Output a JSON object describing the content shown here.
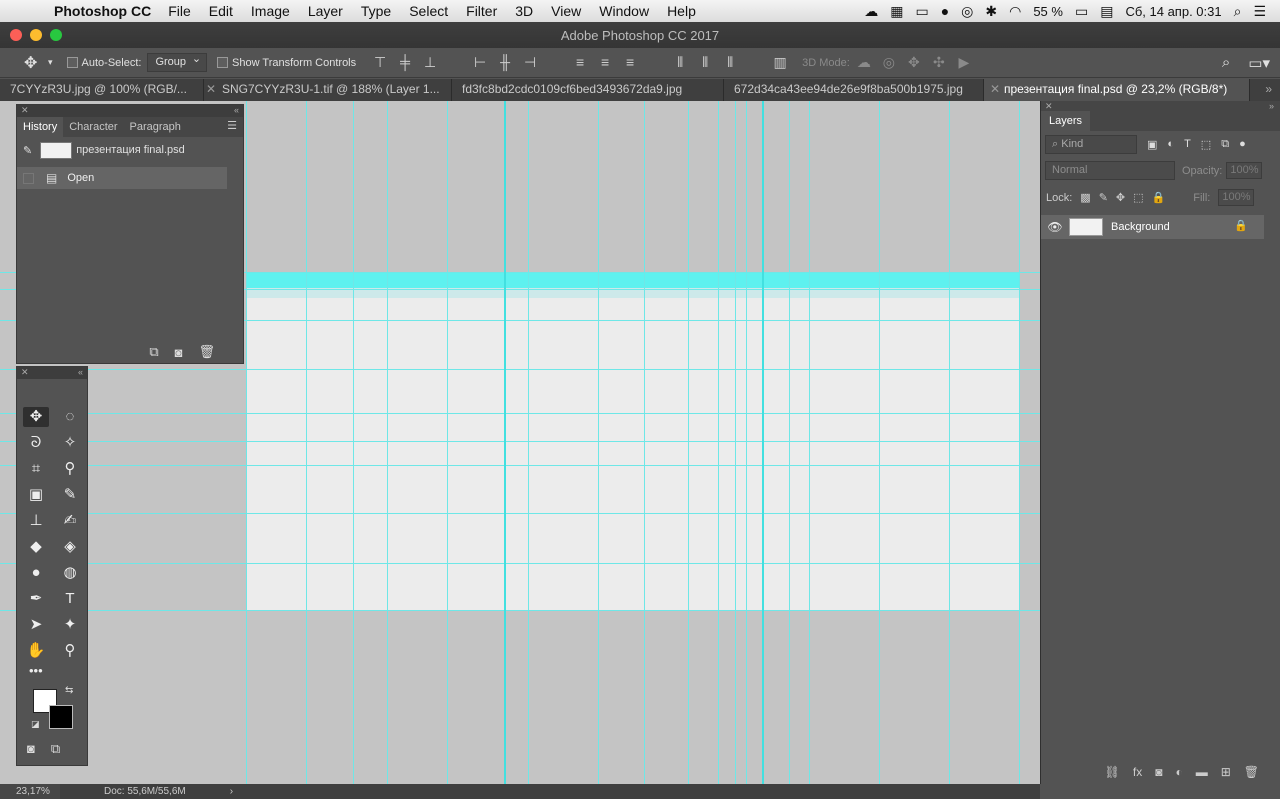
{
  "menubar": {
    "app": "Photoshop CC",
    "items": [
      "File",
      "Edit",
      "Image",
      "Layer",
      "Type",
      "Select",
      "Filter",
      "3D",
      "View",
      "Window",
      "Help"
    ],
    "battery": "55 %",
    "datetime": "Сб, 14 апр.  0:31"
  },
  "window": {
    "title": "Adobe Photoshop CC 2017"
  },
  "options": {
    "auto_select_label": "Auto-Select:",
    "auto_select_value": "Group",
    "transform_label": "Show Transform Controls",
    "mode3d_label": "3D Mode:"
  },
  "tabs": [
    {
      "label": "7CYYzR3U.jpg @ 100% (RGB/..."
    },
    {
      "label": "SNG7CYYzR3U-1.tif @ 188% (Layer 1..."
    },
    {
      "label": "fd3fc8bd2cdc0109cf6bed3493672da9.jpg"
    },
    {
      "label": "672d34ca43ee94de26e9f8ba500b1975.jpg"
    },
    {
      "label": "презентация final.psd @ 23,2% (RGB/8*)"
    }
  ],
  "history": {
    "tabs": [
      "History",
      "Character",
      "Paragraph"
    ],
    "snapshot": "презентация final.psd",
    "steps": [
      "Open"
    ]
  },
  "layers": {
    "tab": "Layers",
    "kind_placeholder": "Kind",
    "blend_mode": "Normal",
    "opacity_label": "Opacity:",
    "opacity_value": "100%",
    "lock_label": "Lock:",
    "fill_label": "Fill:",
    "fill_value": "100%",
    "items": [
      {
        "name": "Background",
        "locked": true,
        "visible": true
      }
    ]
  },
  "status": {
    "zoom": "23,17%",
    "doc": "Doc: 55,6M/55,6M"
  },
  "colors": {
    "guide": "#6ee7e7",
    "canvas_bg": "#c4c4c4",
    "document": "#ececec",
    "header_band": "#5ef1ef"
  },
  "icons": {
    "foreground_color": "#ffffff",
    "background_color": "#000000"
  }
}
